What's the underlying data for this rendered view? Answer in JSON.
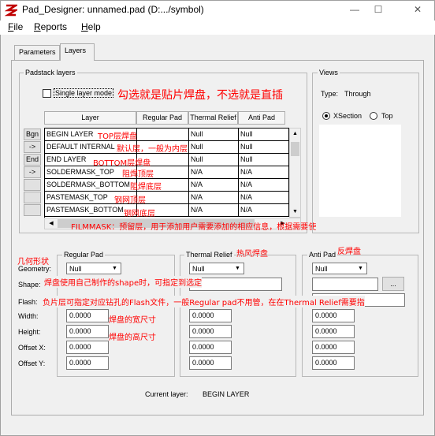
{
  "window": {
    "title": "Pad_Designer: unnamed.pad (D:.../symbol)",
    "min": "—",
    "max": "☐",
    "close": "✕"
  },
  "menu": {
    "file": {
      "first": "F",
      "rest": "ile"
    },
    "reports": {
      "first": "R",
      "rest": "eports"
    },
    "help": {
      "first": "H",
      "rest": "elp"
    }
  },
  "tabs": [
    "Parameters",
    "Layers"
  ],
  "padstack": {
    "group_label": "Padstack layers",
    "single_layer_mode": "Single layer mode",
    "columns": [
      "Layer",
      "Regular Pad",
      "Thermal Relief",
      "Anti Pad"
    ],
    "side_buttons": [
      "Bgn",
      "->",
      "End",
      "->",
      "",
      ""
    ],
    "rows": [
      {
        "layer": "BEGIN LAYER",
        "regular": "",
        "thermal": "Null",
        "anti": "Null"
      },
      {
        "layer": "DEFAULT INTERNAL",
        "regular": "",
        "thermal": "Null",
        "anti": "Null"
      },
      {
        "layer": "END LAYER",
        "regular": "",
        "thermal": "Null",
        "anti": "Null"
      },
      {
        "layer": "SOLDERMASK_TOP",
        "regular": "",
        "thermal": "N/A",
        "anti": "N/A"
      },
      {
        "layer": "SOLDERMASK_BOTTOM",
        "regular": "",
        "thermal": "N/A",
        "anti": "N/A"
      },
      {
        "layer": "PASTEMASK_TOP",
        "regular": "",
        "thermal": "N/A",
        "anti": "N/A"
      },
      {
        "layer": "PASTEMASK_BOTTOM",
        "regular": "",
        "thermal": "N/A",
        "anti": "N/A"
      }
    ]
  },
  "views": {
    "group_label": "Views",
    "type_label": "Type:",
    "type_value": "Through",
    "xsection": "XSection",
    "top": "Top"
  },
  "regular_pad": {
    "group_label": "Regular Pad",
    "geometry_label": "Geometry:",
    "geometry_value": "Null",
    "shape_label": "Shape:",
    "flash_label": "Flash:",
    "width_label": "Width:",
    "width_value": "0.0000",
    "height_label": "Height:",
    "height_value": "0.0000",
    "offx_label": "Offset X:",
    "offx_value": "0.0000",
    "offy_label": "Offset Y:",
    "offy_value": "0.0000"
  },
  "thermal_relief": {
    "group_label": "Thermal Relief",
    "geometry_value": "Null",
    "width_value": "0.0000",
    "height_value": "0.0000",
    "offx_value": "0.0000",
    "offy_value": "0.0000"
  },
  "anti_pad": {
    "group_label": "Anti Pad",
    "geometry_value": "Null",
    "browse": "...",
    "width_value": "0.0000",
    "height_value": "0.0000",
    "offx_value": "0.0000",
    "offy_value": "0.0000"
  },
  "current_layer_label": "Current layer:",
  "current_layer_value": "BEGIN LAYER",
  "annotations": {
    "single_mode": "勾选就是贴片焊盘，不选就是直插",
    "top": "TOP层焊盘",
    "internal": "默认层，一般为内层",
    "bottom": "BOTTOM层焊盘",
    "sm_top": "阻焊顶层",
    "sm_bottom": "阻焊底层",
    "pm_top": "钢网顶层",
    "pm_bottom": "钢网底层",
    "filmmask": "FILMMASK：预留层，用于添加用户需要添加的相应信息，根据需要使",
    "geometry": "几何形状",
    "thermal": "热风焊盘",
    "anti": "反焊盘",
    "shape": "焊盘使用自己制作的shape时，可指定到选定",
    "flash": "负片层可指定对应钻孔的Flash文件，一般Regular pad不用管，在在Thermal Relief需要指",
    "width": "焊盘的宽尺寸",
    "height": "焊盘的高尺寸"
  }
}
